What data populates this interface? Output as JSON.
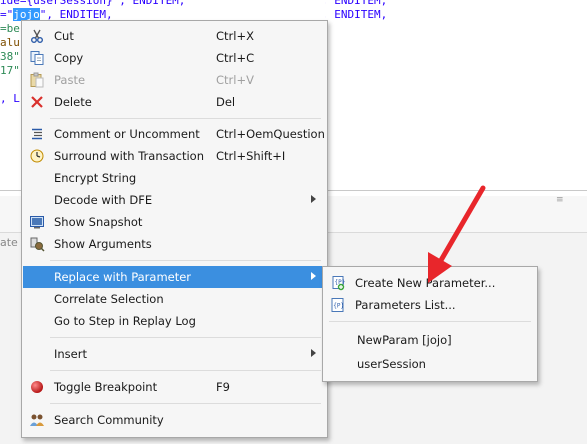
{
  "editor": {
    "lines": [
      {
        "text": "ide={userSession}\", ENDITEM,",
        "cls": "ln"
      },
      {
        "pre": "=\"",
        "sel": "jojo",
        "post": "\", ENDITEM,",
        "cls": "ln"
      },
      {
        "text": "=be",
        "cls": "ln g"
      },
      {
        "text": "alu",
        "cls": "ln o"
      },
      {
        "text": "38\"",
        "cls": "ln g"
      },
      {
        "text": "17\"",
        "cls": "ln g"
      },
      {
        "text": "",
        "cls": "ln"
      },
      {
        "text": ", L",
        "cls": "ln"
      }
    ],
    "right_text": "                                                ",
    "panel_partial_tab": "ate"
  },
  "context_menu": {
    "items": [
      {
        "label": "Cut",
        "shortcut": "Ctrl+X",
        "icon": "scissors-icon"
      },
      {
        "label": "Copy",
        "shortcut": "Ctrl+C",
        "icon": "copy-icon"
      },
      {
        "label": "Paste",
        "shortcut": "Ctrl+V",
        "icon": "paste-icon",
        "disabled": true
      },
      {
        "label": "Delete",
        "shortcut": "Del",
        "icon": "delete-icon"
      },
      {
        "label": "Comment or Uncomment",
        "shortcut": "Ctrl+OemQuestion",
        "icon": "comment-icon"
      },
      {
        "label": "Surround with Transaction",
        "shortcut": "Ctrl+Shift+I",
        "icon": "transaction-icon"
      },
      {
        "label": "Encrypt String",
        "shortcut": ""
      },
      {
        "label": "Decode with DFE",
        "shortcut": "",
        "submenu": true
      },
      {
        "label": "Show Snapshot",
        "shortcut": "",
        "icon": "snapshot-icon"
      },
      {
        "label": "Show Arguments",
        "shortcut": "",
        "icon": "arguments-icon"
      },
      {
        "label": "Replace with Parameter",
        "shortcut": "",
        "submenu": true,
        "highlighted": true
      },
      {
        "label": "Correlate Selection",
        "shortcut": ""
      },
      {
        "label": "Go to Step in Replay Log",
        "shortcut": ""
      },
      {
        "label": "Insert",
        "shortcut": "",
        "submenu": true
      },
      {
        "label": "Toggle Breakpoint",
        "shortcut": "F9",
        "icon": "breakpoint-icon"
      },
      {
        "label": "Search Community",
        "shortcut": "",
        "icon": "community-icon"
      }
    ]
  },
  "submenu": {
    "items": [
      {
        "label": "Create New Parameter...",
        "icon": "new-parameter-icon"
      },
      {
        "label": "Parameters List...",
        "icon": "parameters-list-icon"
      },
      {
        "label": "NewParam [jojo]"
      },
      {
        "label": "userSession"
      }
    ]
  },
  "colors": {
    "highlight": "#3b8fe0",
    "annotation_arrow": "#e8262b",
    "selection": "#3399ff"
  }
}
